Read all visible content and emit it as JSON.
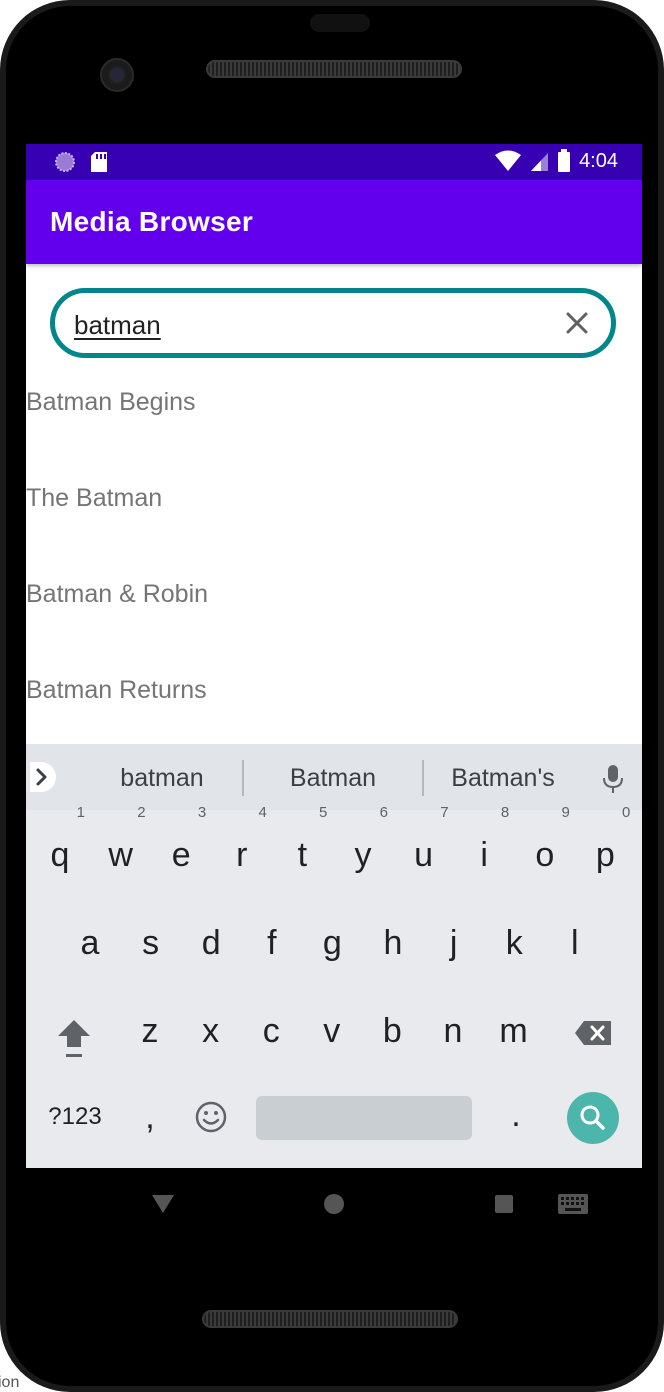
{
  "status_bar": {
    "time": "4:04",
    "icons": [
      "circle-app-icon",
      "sd-card-icon",
      "wifi-icon",
      "signal-icon",
      "battery-icon"
    ]
  },
  "app_bar": {
    "title": "Media Browser"
  },
  "search": {
    "query": "batman",
    "clear_icon": "close-icon"
  },
  "results": [
    {
      "title": "Batman Begins"
    },
    {
      "title": "The Batman"
    },
    {
      "title": "Batman & Robin"
    },
    {
      "title": "Batman Returns"
    }
  ],
  "keyboard": {
    "suggestions": [
      "batman",
      "Batman",
      "Batman's"
    ],
    "row1": [
      {
        "key": "q",
        "hint": "1"
      },
      {
        "key": "w",
        "hint": "2"
      },
      {
        "key": "e",
        "hint": "3"
      },
      {
        "key": "r",
        "hint": "4"
      },
      {
        "key": "t",
        "hint": "5"
      },
      {
        "key": "y",
        "hint": "6"
      },
      {
        "key": "u",
        "hint": "7"
      },
      {
        "key": "i",
        "hint": "8"
      },
      {
        "key": "o",
        "hint": "9"
      },
      {
        "key": "p",
        "hint": "0"
      }
    ],
    "row2": [
      "a",
      "s",
      "d",
      "f",
      "g",
      "h",
      "j",
      "k",
      "l"
    ],
    "row3": [
      "z",
      "x",
      "c",
      "v",
      "b",
      "n",
      "m"
    ],
    "symbols_label": "?123",
    "comma": ",",
    "period": ".",
    "emoji_icon": "emoji-icon",
    "enter_icon": "search-icon",
    "shift_icon": "shift-icon",
    "backspace_icon": "backspace-icon"
  },
  "nav_bar": {
    "icons": [
      "back-icon",
      "home-icon",
      "recents-icon",
      "keyboard-icon"
    ]
  },
  "colors": {
    "status_bar": "#3700b3",
    "app_bar": "#6200ee",
    "search_border": "#00868b",
    "enter_key": "#4db6ac"
  },
  "corner_text": "ion"
}
